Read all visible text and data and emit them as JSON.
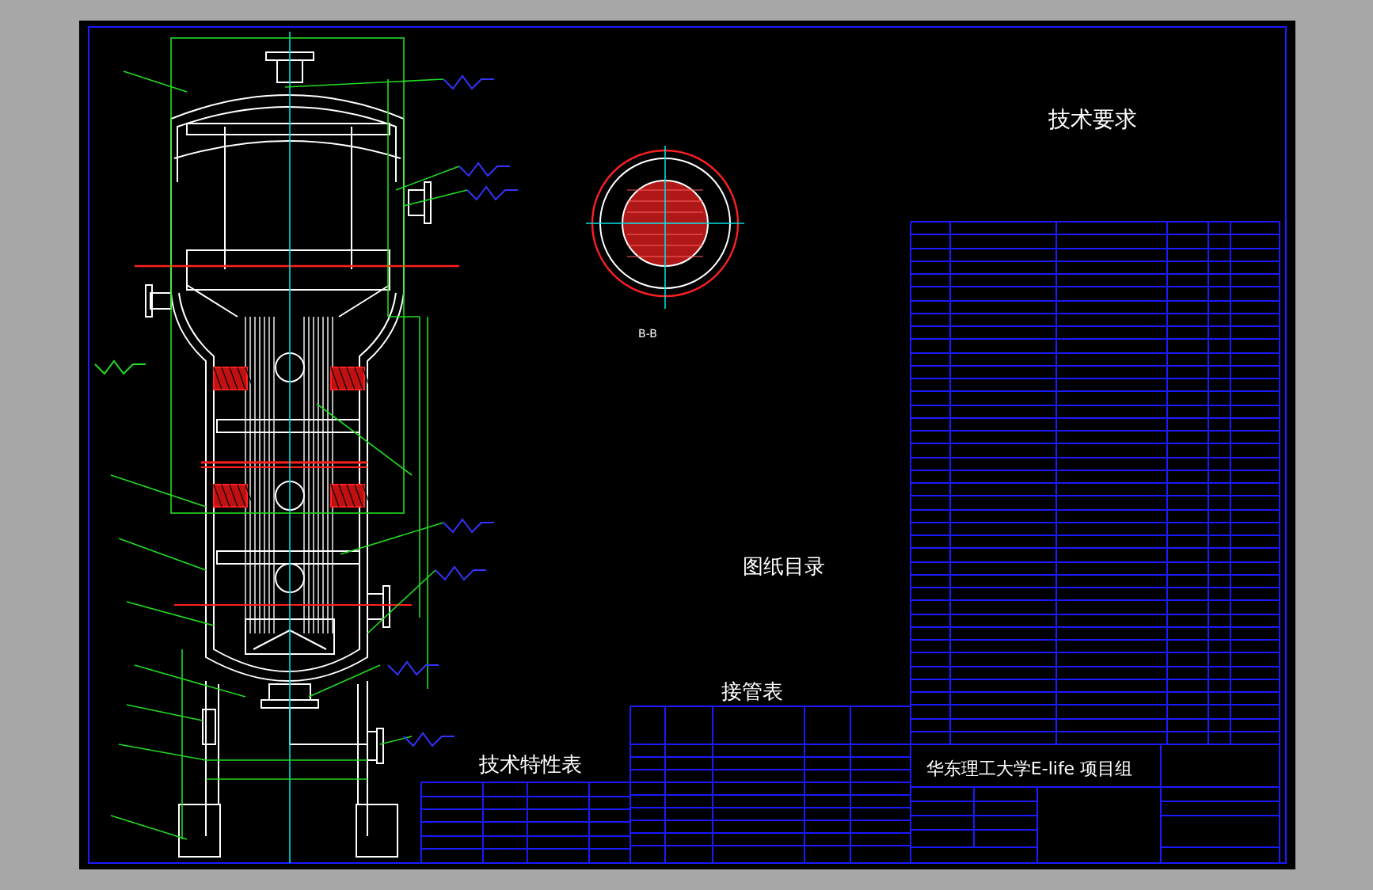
{
  "drawing": {
    "labels": [
      {
        "kind": "heading",
        "text": "技术要求"
      },
      {
        "kind": "section",
        "text": "B-B"
      },
      {
        "kind": "heading",
        "text": "图纸目录"
      },
      {
        "kind": "heading",
        "text": "接管表"
      },
      {
        "kind": "heading",
        "text": "技术特性表"
      },
      {
        "kind": "title",
        "text": "华东理工大学E-life 项目组"
      }
    ]
  }
}
